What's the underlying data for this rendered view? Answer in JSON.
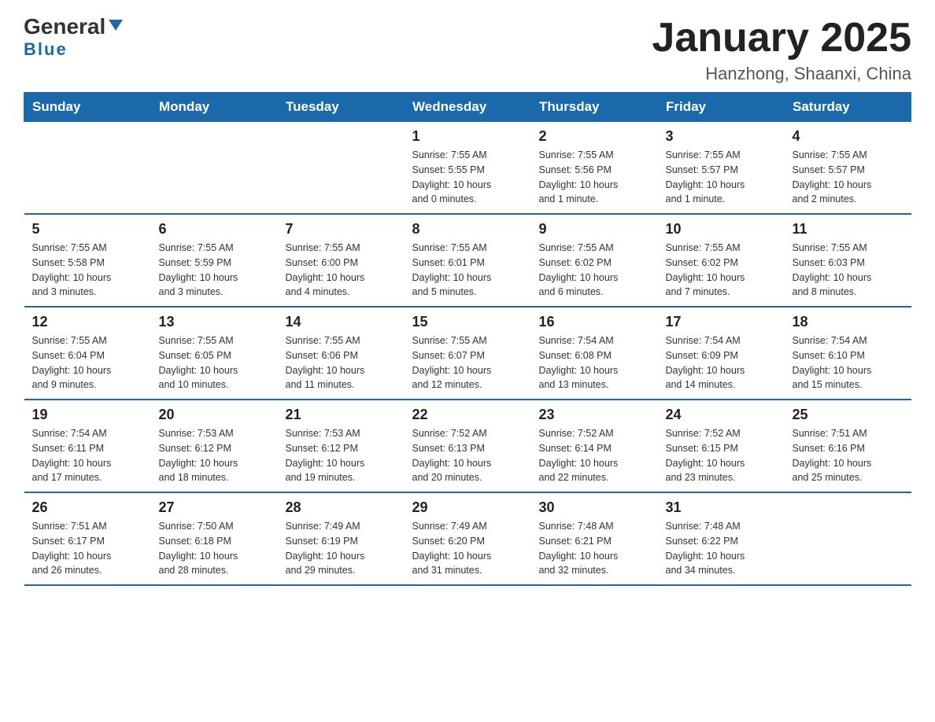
{
  "header": {
    "logo_general": "General",
    "logo_blue": "Blue",
    "month_title": "January 2025",
    "location": "Hanzhong, Shaanxi, China"
  },
  "weekdays": [
    "Sunday",
    "Monday",
    "Tuesday",
    "Wednesday",
    "Thursday",
    "Friday",
    "Saturday"
  ],
  "weeks": [
    [
      {
        "day": "",
        "info": ""
      },
      {
        "day": "",
        "info": ""
      },
      {
        "day": "",
        "info": ""
      },
      {
        "day": "1",
        "info": "Sunrise: 7:55 AM\nSunset: 5:55 PM\nDaylight: 10 hours\nand 0 minutes."
      },
      {
        "day": "2",
        "info": "Sunrise: 7:55 AM\nSunset: 5:56 PM\nDaylight: 10 hours\nand 1 minute."
      },
      {
        "day": "3",
        "info": "Sunrise: 7:55 AM\nSunset: 5:57 PM\nDaylight: 10 hours\nand 1 minute."
      },
      {
        "day": "4",
        "info": "Sunrise: 7:55 AM\nSunset: 5:57 PM\nDaylight: 10 hours\nand 2 minutes."
      }
    ],
    [
      {
        "day": "5",
        "info": "Sunrise: 7:55 AM\nSunset: 5:58 PM\nDaylight: 10 hours\nand 3 minutes."
      },
      {
        "day": "6",
        "info": "Sunrise: 7:55 AM\nSunset: 5:59 PM\nDaylight: 10 hours\nand 3 minutes."
      },
      {
        "day": "7",
        "info": "Sunrise: 7:55 AM\nSunset: 6:00 PM\nDaylight: 10 hours\nand 4 minutes."
      },
      {
        "day": "8",
        "info": "Sunrise: 7:55 AM\nSunset: 6:01 PM\nDaylight: 10 hours\nand 5 minutes."
      },
      {
        "day": "9",
        "info": "Sunrise: 7:55 AM\nSunset: 6:02 PM\nDaylight: 10 hours\nand 6 minutes."
      },
      {
        "day": "10",
        "info": "Sunrise: 7:55 AM\nSunset: 6:02 PM\nDaylight: 10 hours\nand 7 minutes."
      },
      {
        "day": "11",
        "info": "Sunrise: 7:55 AM\nSunset: 6:03 PM\nDaylight: 10 hours\nand 8 minutes."
      }
    ],
    [
      {
        "day": "12",
        "info": "Sunrise: 7:55 AM\nSunset: 6:04 PM\nDaylight: 10 hours\nand 9 minutes."
      },
      {
        "day": "13",
        "info": "Sunrise: 7:55 AM\nSunset: 6:05 PM\nDaylight: 10 hours\nand 10 minutes."
      },
      {
        "day": "14",
        "info": "Sunrise: 7:55 AM\nSunset: 6:06 PM\nDaylight: 10 hours\nand 11 minutes."
      },
      {
        "day": "15",
        "info": "Sunrise: 7:55 AM\nSunset: 6:07 PM\nDaylight: 10 hours\nand 12 minutes."
      },
      {
        "day": "16",
        "info": "Sunrise: 7:54 AM\nSunset: 6:08 PM\nDaylight: 10 hours\nand 13 minutes."
      },
      {
        "day": "17",
        "info": "Sunrise: 7:54 AM\nSunset: 6:09 PM\nDaylight: 10 hours\nand 14 minutes."
      },
      {
        "day": "18",
        "info": "Sunrise: 7:54 AM\nSunset: 6:10 PM\nDaylight: 10 hours\nand 15 minutes."
      }
    ],
    [
      {
        "day": "19",
        "info": "Sunrise: 7:54 AM\nSunset: 6:11 PM\nDaylight: 10 hours\nand 17 minutes."
      },
      {
        "day": "20",
        "info": "Sunrise: 7:53 AM\nSunset: 6:12 PM\nDaylight: 10 hours\nand 18 minutes."
      },
      {
        "day": "21",
        "info": "Sunrise: 7:53 AM\nSunset: 6:12 PM\nDaylight: 10 hours\nand 19 minutes."
      },
      {
        "day": "22",
        "info": "Sunrise: 7:52 AM\nSunset: 6:13 PM\nDaylight: 10 hours\nand 20 minutes."
      },
      {
        "day": "23",
        "info": "Sunrise: 7:52 AM\nSunset: 6:14 PM\nDaylight: 10 hours\nand 22 minutes."
      },
      {
        "day": "24",
        "info": "Sunrise: 7:52 AM\nSunset: 6:15 PM\nDaylight: 10 hours\nand 23 minutes."
      },
      {
        "day": "25",
        "info": "Sunrise: 7:51 AM\nSunset: 6:16 PM\nDaylight: 10 hours\nand 25 minutes."
      }
    ],
    [
      {
        "day": "26",
        "info": "Sunrise: 7:51 AM\nSunset: 6:17 PM\nDaylight: 10 hours\nand 26 minutes."
      },
      {
        "day": "27",
        "info": "Sunrise: 7:50 AM\nSunset: 6:18 PM\nDaylight: 10 hours\nand 28 minutes."
      },
      {
        "day": "28",
        "info": "Sunrise: 7:49 AM\nSunset: 6:19 PM\nDaylight: 10 hours\nand 29 minutes."
      },
      {
        "day": "29",
        "info": "Sunrise: 7:49 AM\nSunset: 6:20 PM\nDaylight: 10 hours\nand 31 minutes."
      },
      {
        "day": "30",
        "info": "Sunrise: 7:48 AM\nSunset: 6:21 PM\nDaylight: 10 hours\nand 32 minutes."
      },
      {
        "day": "31",
        "info": "Sunrise: 7:48 AM\nSunset: 6:22 PM\nDaylight: 10 hours\nand 34 minutes."
      },
      {
        "day": "",
        "info": ""
      }
    ]
  ]
}
